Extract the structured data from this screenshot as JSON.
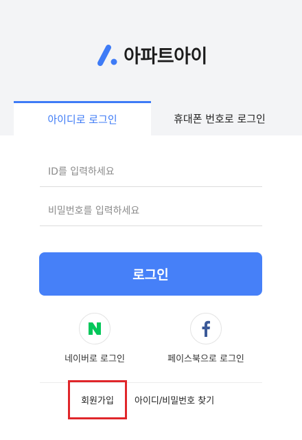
{
  "brand": {
    "logo_text": "아파트아이",
    "accent_color": "#3e7bf6",
    "logo_icon": "apt-i-logo-icon"
  },
  "tabs": [
    {
      "label": "아이디로 로그인",
      "active": true
    },
    {
      "label": "휴대폰 번호로 로그인",
      "active": false
    }
  ],
  "form": {
    "id_placeholder": "ID를 입력하세요",
    "id_value": "",
    "password_placeholder": "비밀번호를 입력하세요",
    "password_value": "",
    "login_label": "로그인",
    "login_color": "#4680f8"
  },
  "social": [
    {
      "label": "네이버로 로그인",
      "icon": "naver-icon",
      "color": "#03c75a"
    },
    {
      "label": "페이스북으로 로그인",
      "icon": "facebook-icon",
      "color": "#3b5998"
    }
  ],
  "footer": {
    "signup_label": "회원가입",
    "find_label": "아이디/비밀번호 찾기",
    "highlight_color": "#e0262a"
  }
}
